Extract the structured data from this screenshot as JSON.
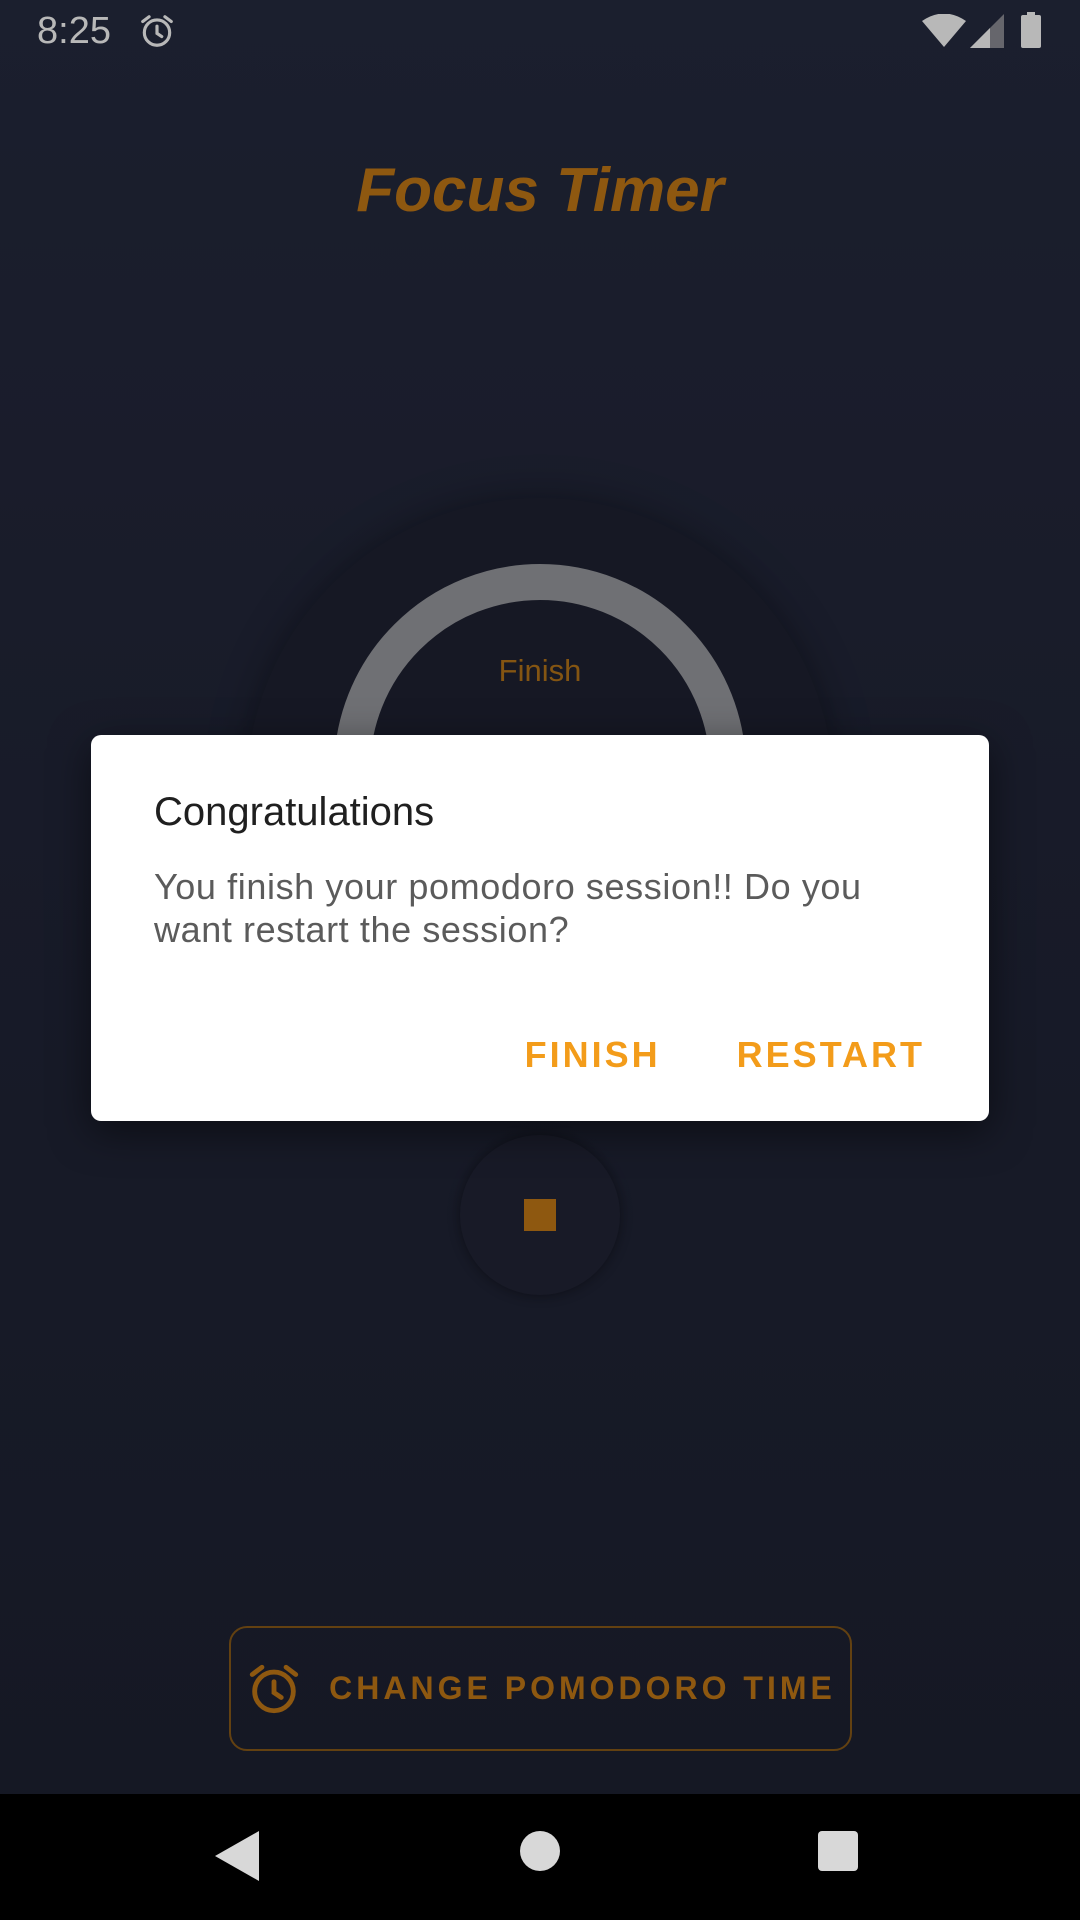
{
  "status_bar": {
    "time": "8:25",
    "icons": [
      "alarm-icon",
      "wifi-icon",
      "signal-icon",
      "battery-icon"
    ]
  },
  "app": {
    "title": "Focus Timer",
    "timer_label": "Finish",
    "stop_icon": "stop-icon",
    "change_button": {
      "icon": "alarm-clock-icon",
      "label": "CHANGE POMODORO TIME"
    }
  },
  "dialog": {
    "title": "Congratulations",
    "message": "You finish your pomodoro session!! Do you want restart the session?",
    "buttons": {
      "finish": "FINISH",
      "restart": "RESTART"
    }
  },
  "nav_bar": {
    "icons": [
      "back-icon",
      "home-icon",
      "recents-icon"
    ]
  },
  "colors": {
    "accent": "#c57a17",
    "dialog_button": "#f39c1a",
    "background": "#222639"
  }
}
